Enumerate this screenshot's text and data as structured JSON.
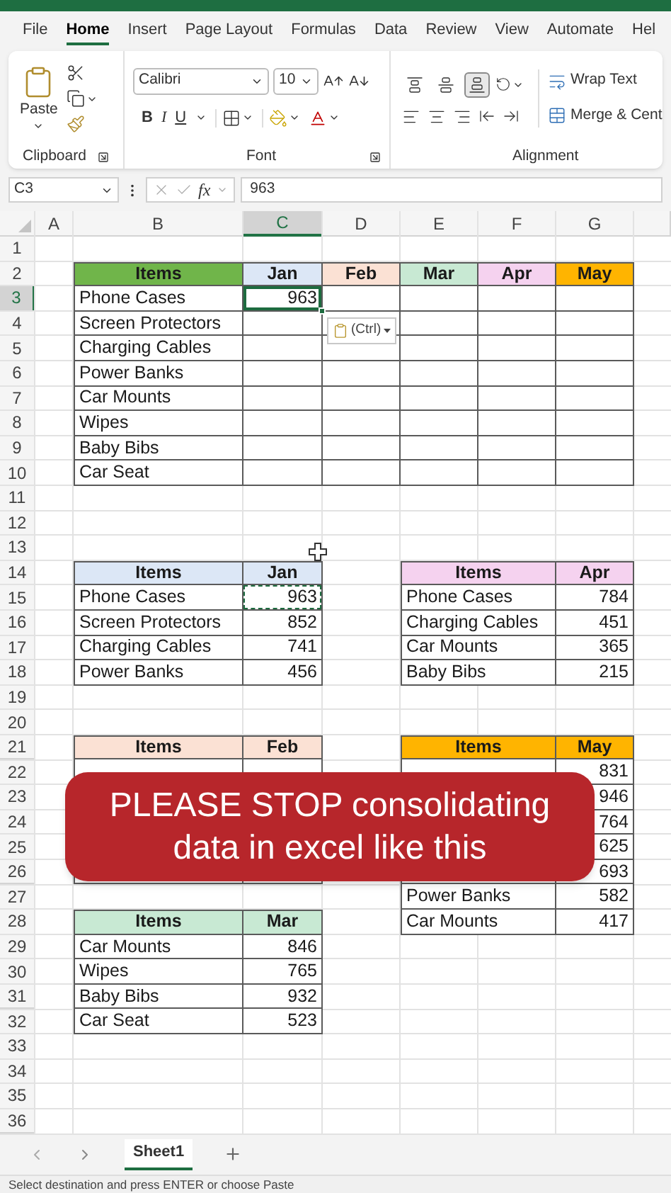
{
  "tabs": [
    {
      "label": "File",
      "selected": false
    },
    {
      "label": "Home",
      "selected": true
    },
    {
      "label": "Insert",
      "selected": false
    },
    {
      "label": "Page Layout",
      "selected": false
    },
    {
      "label": "Formulas",
      "selected": false
    },
    {
      "label": "Data",
      "selected": false
    },
    {
      "label": "Review",
      "selected": false
    },
    {
      "label": "View",
      "selected": false
    },
    {
      "label": "Automate",
      "selected": false
    },
    {
      "label": "Hel",
      "selected": false
    }
  ],
  "ribbon": {
    "clipboard": {
      "paste": "Paste",
      "label": "Clipboard"
    },
    "font": {
      "name": "Calibri",
      "size": "10",
      "styles": [
        "B",
        "I",
        "U"
      ],
      "label": "Font"
    },
    "alignment": {
      "vertical": [
        {
          "kind": "top",
          "selected": false
        },
        {
          "kind": "middle",
          "selected": false
        },
        {
          "kind": "bottom",
          "selected": true
        }
      ],
      "wrap": "Wrap Text",
      "merge": "Merge & Cent",
      "label": "Alignment"
    }
  },
  "formula_bar": {
    "name_box": "C3",
    "fx": "fx",
    "value": "963"
  },
  "sheet": {
    "columns": [
      "A",
      "B",
      "C",
      "D",
      "E",
      "F",
      "G"
    ],
    "rows": [
      "1",
      "2",
      "3",
      "4",
      "5",
      "6",
      "7",
      "8",
      "9",
      "10",
      "11",
      "12",
      "13",
      "14",
      "15",
      "16",
      "17",
      "18",
      "19",
      "20",
      "21",
      "22",
      "23",
      "24",
      "25",
      "26",
      "27",
      "28",
      "29",
      "30",
      "31",
      "32",
      "33",
      "34",
      "35",
      "36"
    ],
    "tables": [
      {
        "header": [
          {
            "text": "Items",
            "color": "#70b54a"
          },
          {
            "text": "Jan",
            "color": "#dce7f6"
          },
          {
            "text": "Feb",
            "color": "#fbe1d4"
          },
          {
            "text": "Mar",
            "color": "#c8e9d3"
          },
          {
            "text": "Apr",
            "color": "#f5d2ef"
          },
          {
            "text": "May",
            "color": "#ffb400"
          }
        ],
        "rows": [
          {
            "item": "Phone Cases",
            "values": [
              "963"
            ],
            "selected": true
          },
          {
            "item": "Screen Protectors",
            "selected": false
          },
          {
            "item": "Charging Cables",
            "selected": false
          },
          {
            "item": "Power Banks",
            "selected": false
          },
          {
            "item": "Car Mounts",
            "selected": false
          },
          {
            "item": "Wipes",
            "selected": false
          },
          {
            "item": "Baby Bibs",
            "selected": false
          },
          {
            "item": "Car Seat",
            "selected": false
          }
        ]
      },
      {
        "header": [
          {
            "text": "Items",
            "color": "#dce7f6"
          },
          {
            "text": "Jan",
            "color": "#dce7f6"
          }
        ],
        "rows": [
          {
            "item": "Phone Cases",
            "values": [
              "963"
            ],
            "copied": true
          },
          {
            "item": "Screen Protectors",
            "values": [
              "852"
            ],
            "copied": false
          },
          {
            "item": "Charging Cables",
            "values": [
              "741"
            ],
            "copied": false
          },
          {
            "item": "Power Banks",
            "values": [
              "456"
            ],
            "copied": false
          }
        ]
      },
      {
        "header": [
          {
            "text": "Items",
            "color": "#f5d2ef"
          },
          {
            "text": "Apr",
            "color": "#f5d2ef"
          }
        ],
        "rows": [
          {
            "item": "Phone Cases",
            "values": [
              "784"
            ]
          },
          {
            "item": "Charging Cables",
            "values": [
              "451"
            ]
          },
          {
            "item": "Car Mounts",
            "values": [
              "365"
            ]
          },
          {
            "item": "Baby Bibs",
            "values": [
              "215"
            ]
          }
        ]
      },
      {
        "header": [
          {
            "text": "Items",
            "color": "#fbe1d4"
          },
          {
            "text": "Feb",
            "color": "#fbe1d4"
          }
        ]
      },
      {
        "header": [
          {
            "text": "Items",
            "color": "#ffb400"
          },
          {
            "text": "May",
            "color": "#ffb400"
          }
        ],
        "rows": [
          {
            "values": [
              "831"
            ]
          },
          {
            "values": [
              "946"
            ]
          },
          {
            "values": [
              "764"
            ]
          },
          {
            "values": [
              "625"
            ]
          },
          {
            "values": [
              "693"
            ]
          },
          {
            "item": "Power Banks",
            "values": [
              "582"
            ]
          },
          {
            "item": "Car Mounts",
            "values": [
              "417"
            ]
          }
        ]
      },
      {
        "header": [
          {
            "text": "Items",
            "color": "#c8e9d3"
          },
          {
            "text": "Mar",
            "color": "#c8e9d3"
          }
        ],
        "rows": [
          {
            "item": "Car Mounts",
            "values": [
              "846"
            ]
          },
          {
            "item": "Wipes",
            "values": [
              "765"
            ]
          },
          {
            "item": "Baby Bibs",
            "values": [
              "932"
            ]
          },
          {
            "item": "Car Seat",
            "values": [
              "523"
            ]
          }
        ]
      }
    ],
    "paste_options": "(Ctrl)",
    "banner": "PLEASE STOP consolidating data in excel like this"
  },
  "sheet_tabs": [
    {
      "label": "Sheet1",
      "selected": true
    }
  ],
  "status_bar": "Select destination and press ENTER or choose Paste"
}
